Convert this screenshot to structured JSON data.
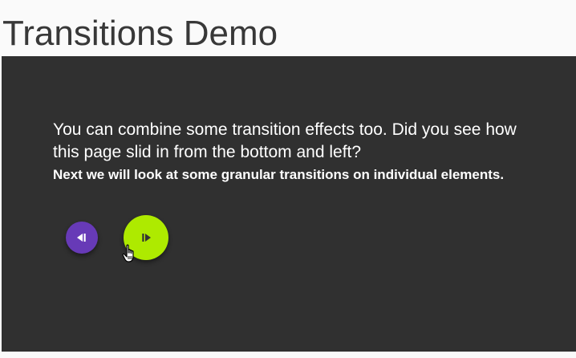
{
  "header": {
    "title": "Transitions Demo"
  },
  "slide": {
    "lead": "You can combine some transition effects too. Did you see how this page slid in from the bottom and left?",
    "sub": "Next we will look at some granular transitions on individual elements."
  },
  "controls": {
    "prev_icon": "skip-previous-icon",
    "next_icon": "skip-next-icon",
    "prev_color": "#673ab7",
    "next_color": "#aeea00"
  },
  "colors": {
    "stage_background": "#303030",
    "page_background": "#fafafa",
    "title_color": "#383838",
    "text_color": "#ffffff"
  }
}
